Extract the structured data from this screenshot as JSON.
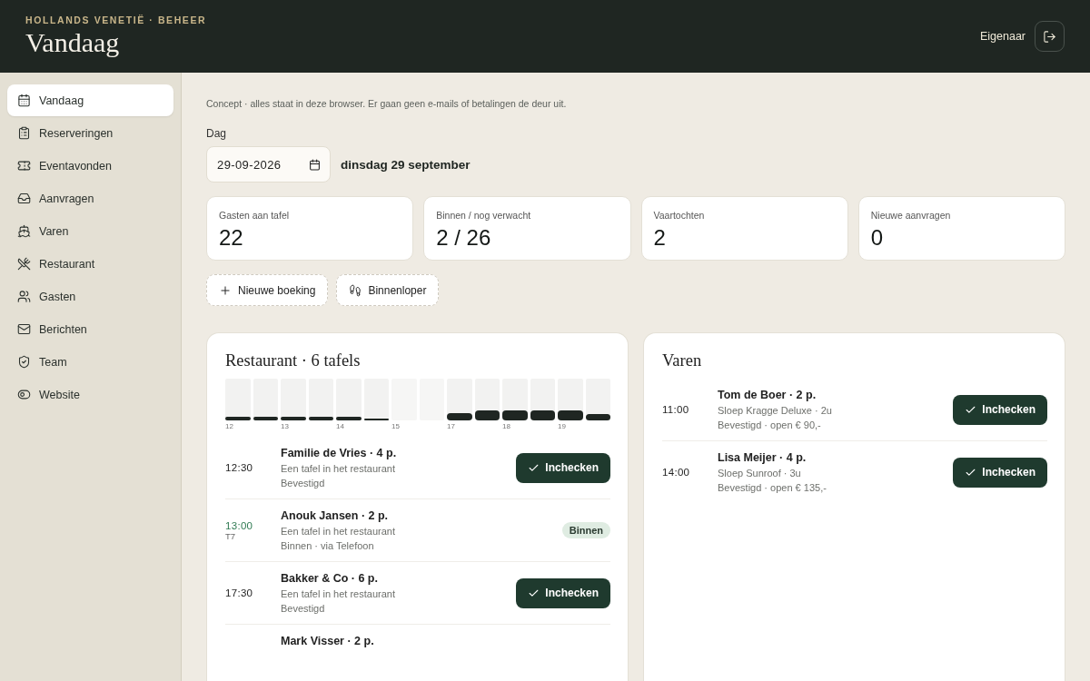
{
  "header": {
    "brand": "HOLLANDS VENETIË · BEHEER",
    "title": "Vandaag",
    "user": "Eigenaar"
  },
  "sidebar": {
    "items": [
      {
        "label": "Vandaag",
        "selected": true
      },
      {
        "label": "Reserveringen",
        "selected": false
      },
      {
        "label": "Eventavonden",
        "selected": false
      },
      {
        "label": "Aanvragen",
        "selected": false
      },
      {
        "label": "Varen",
        "selected": false
      },
      {
        "label": "Restaurant",
        "selected": false
      },
      {
        "label": "Gasten",
        "selected": false
      },
      {
        "label": "Berichten",
        "selected": false
      },
      {
        "label": "Team",
        "selected": false
      },
      {
        "label": "Website",
        "selected": false
      }
    ]
  },
  "notice": "Concept · alles staat in deze browser. Er gaan geen e-mails of betalingen de deur uit.",
  "day": {
    "label": "Dag",
    "value": "29-09-2026",
    "long_date": "dinsdag 29 september"
  },
  "stats": [
    {
      "label": "Gasten aan tafel",
      "value": "22"
    },
    {
      "label": "Binnen / nog verwacht",
      "value": "2 / 26"
    },
    {
      "label": "Vaartochten",
      "value": "2"
    },
    {
      "label": "Nieuwe aanvragen",
      "value": "0"
    }
  ],
  "actions": [
    {
      "label": "Nieuwe boeking"
    },
    {
      "label": "Binnenloper"
    }
  ],
  "restaurant": {
    "title": "Restaurant · 6 tafels",
    "slots": [
      {
        "kind": "booked",
        "label": "12",
        "level": 0.08
      },
      {
        "kind": "booked",
        "level": 0.08
      },
      {
        "kind": "booked",
        "label": "13",
        "level": 0.08
      },
      {
        "kind": "booked",
        "level": 0.08
      },
      {
        "kind": "booked",
        "label": "14",
        "level": 0.08
      },
      {
        "kind": "booked",
        "level": 0.04
      },
      {
        "kind": "free",
        "label": "15"
      },
      {
        "kind": "free"
      },
      {
        "kind": "booked",
        "label": "17",
        "level": 0.17
      },
      {
        "kind": "booked",
        "level": 0.25
      },
      {
        "kind": "booked",
        "label": "18",
        "level": 0.25
      },
      {
        "kind": "booked",
        "level": 0.25
      },
      {
        "kind": "booked",
        "label": "19",
        "level": 0.25
      },
      {
        "kind": "booked",
        "level": 0.15
      }
    ],
    "rows": [
      {
        "time": "12:30",
        "name": "Familie de Vries · 4 p.",
        "detail": "Een tafel in het restaurant",
        "status": "Bevestigd",
        "checked_in": false,
        "action": "Inchecken"
      },
      {
        "time": "13:00",
        "table": "T7",
        "name": "Anouk Jansen · 2 p.",
        "detail": "Een tafel in het restaurant",
        "status": "Binnen · via Telefoon",
        "checked_in": true,
        "action": "Binnen"
      },
      {
        "time": "17:30",
        "name": "Bakker & Co · 6 p.",
        "detail": "Een tafel in het restaurant",
        "status": "Bevestigd",
        "checked_in": false,
        "action": "Inchecken"
      },
      {
        "name": "Mark Visser · 2 p."
      }
    ]
  },
  "boats": {
    "title": "Varen",
    "rows": [
      {
        "time": "11:00",
        "name": "Tom de Boer · 2 p.",
        "detail": "Sloep Kragge Deluxe · 2u",
        "status": "Bevestigd · open € 90,-",
        "checked_in": false,
        "action": "Inchecken"
      },
      {
        "time": "14:00",
        "name": "Lisa Meijer · 4 p.",
        "detail": "Sloep Sunroof · 3u",
        "status": "Bevestigd · open € 135,-",
        "checked_in": false,
        "action": "Inchecken"
      }
    ]
  }
}
